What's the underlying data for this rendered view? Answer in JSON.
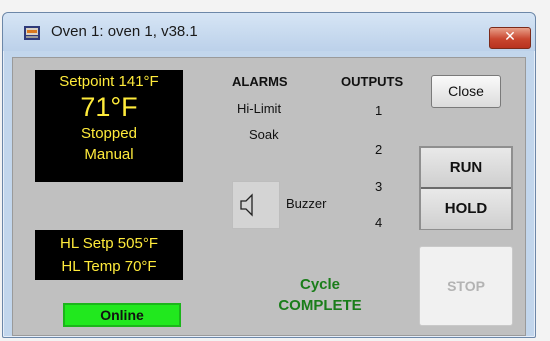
{
  "window": {
    "title": "Oven 1: oven 1, v38.1",
    "close_glyph": "✕"
  },
  "setpoint_panel": {
    "setpoint": "Setpoint 141°F",
    "temperature": "71°F",
    "state": "Stopped",
    "mode": "Manual"
  },
  "hl_panel": {
    "setpoint": "HL Setp 505°F",
    "temperature": "HL Temp 70°F"
  },
  "status": {
    "connection": "Online",
    "cycle_line1": "Cycle",
    "cycle_line2": "COMPLETE"
  },
  "alarms": {
    "header": "ALARMS",
    "items": [
      "Hi-Limit",
      "Soak"
    ],
    "buzzer_label": "Buzzer"
  },
  "outputs": {
    "header": "OUTPUTS",
    "items": [
      "1",
      "2",
      "3",
      "4"
    ]
  },
  "buttons": {
    "close": "Close",
    "run": "RUN",
    "hold": "HOLD",
    "stop": "STOP"
  },
  "icons": {
    "app": "oven-app-icon",
    "speaker": "speaker-icon"
  },
  "colors": {
    "display_bg": "#000000",
    "display_text": "#ffeb3b",
    "online_green": "#21e81e",
    "cycle_green": "#1a7d1a",
    "title_close_red": "#c9462f"
  }
}
